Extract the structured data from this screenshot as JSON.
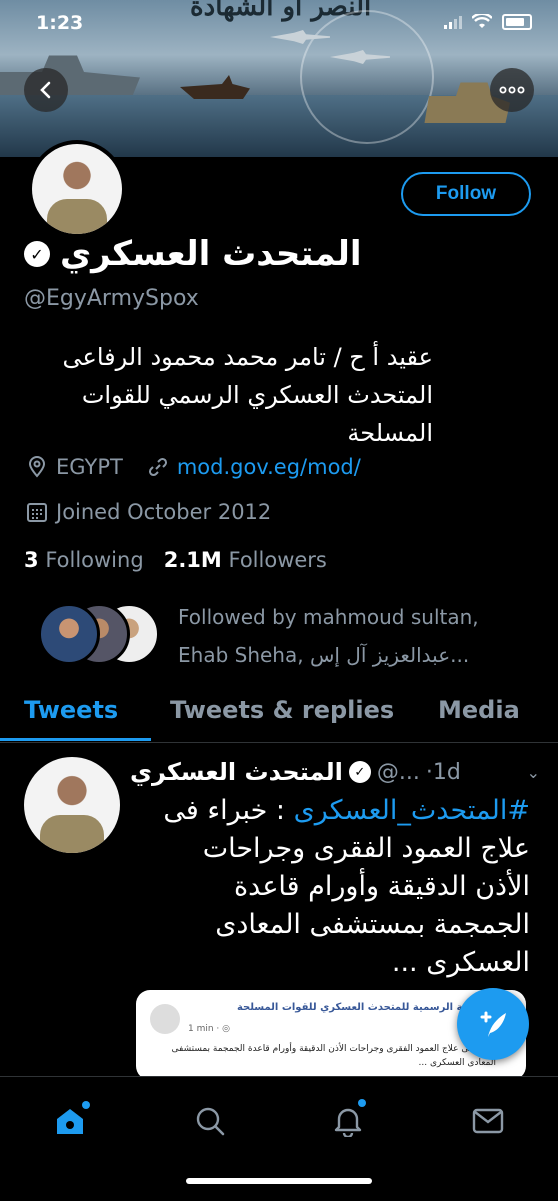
{
  "status_bar": {
    "time": "1:23"
  },
  "profile": {
    "name": "المتحدث العسكري",
    "handle": "@EgyArmySpox",
    "follow_label": "Follow",
    "bio_lines": [
      "عقيد أ ح / تامر محمد محمود الرفاعى",
      "المتحدث العسكري الرسمي للقوات",
      "المسلحة"
    ],
    "location": "EGYPT",
    "website": "mod.gov.eg/mod/",
    "joined": "Joined October 2012",
    "following_count": "3",
    "following_label": "Following",
    "followers_count": "2.1M",
    "followers_label": "Followers",
    "followed_by_line1": "Followed by mahmoud sultan,",
    "followed_by_line2": "Ehab Sheha, عبدالعزيز آل إس..."
  },
  "tabs": [
    {
      "label": "Tweets",
      "active": true
    },
    {
      "label": "Tweets & replies",
      "active": false
    },
    {
      "label": "Media",
      "active": false
    }
  ],
  "tweet": {
    "author": "المتحدث العسكري",
    "handle": "@...",
    "time": "·1d",
    "hashtag": "#المتحدث_العسكرى",
    "text_after_hashtag": ": خبراء فى",
    "text_lines": [
      "علاج العمود الفقرى وجراحات",
      "الأذن الدقيقة وأورام قاعدة",
      "الجمجمة بمستشفى المعادى",
      "العسكرى ..."
    ],
    "card": {
      "title": "الصفحة الرسمية للمتحدث العسكري للقوات المسلحة",
      "meta": "1 min · ◎",
      "body": "خبراء فى علاج العمود الفقرى وجراحات الأذن الدقيقة وأورام قاعدة الجمجمة بمستشفى المعادى العسكرى ..."
    }
  },
  "icons": {
    "back": "back-arrow-icon",
    "more": "more-icon",
    "location": "location-pin-icon",
    "link": "link-icon",
    "calendar": "calendar-icon",
    "compose": "compose-tweet-icon",
    "home": "home-icon",
    "search": "search-icon",
    "notifications": "bell-icon",
    "messages": "mail-icon"
  },
  "colors": {
    "accent": "#1d9bf0",
    "muted": "#8b98a5",
    "background": "#000000"
  }
}
